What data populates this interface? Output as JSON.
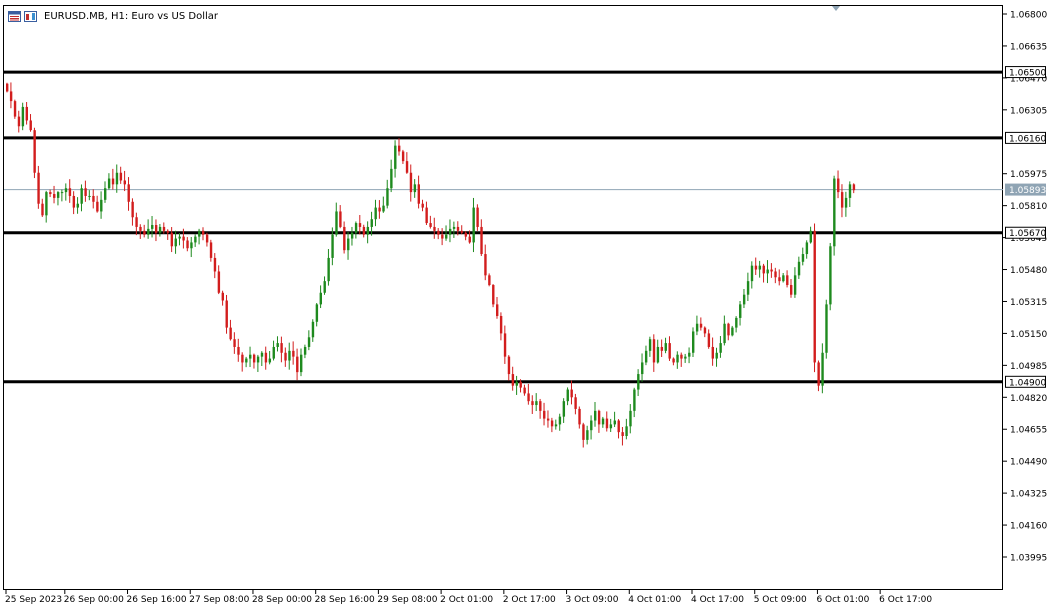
{
  "header": {
    "title": "EURUSD.MB, H1:  Euro vs US Dollar",
    "icons": [
      "chart-menu-icon",
      "one-click-trading-icon"
    ]
  },
  "colors": {
    "bull": "#1e8a1e",
    "bear": "#d21d1d",
    "level_line": "#000000",
    "bid_line": "#8fa4b4",
    "background": "#ffffff"
  },
  "price_axis": {
    "ticks": [
      "1.06800",
      "1.06635",
      "1.06470",
      "1.06305",
      "1.05975",
      "1.05810",
      "1.05645",
      "1.05480",
      "1.05315",
      "1.05150",
      "1.04985",
      "1.04820",
      "1.04655",
      "1.04490",
      "1.04325",
      "1.04160",
      "1.03995"
    ],
    "tick_values": [
      1.068,
      1.06635,
      1.0647,
      1.06305,
      1.05975,
      1.0581,
      1.05645,
      1.0548,
      1.05315,
      1.0515,
      1.04985,
      1.0482,
      1.04655,
      1.0449,
      1.04325,
      1.0416,
      1.03995
    ]
  },
  "time_axis": {
    "labels": [
      "25 Sep 2023",
      "26 Sep 00:00",
      "26 Sep 16:00",
      "27 Sep 08:00",
      "28 Sep 00:00",
      "28 Sep 16:00",
      "29 Sep 08:00",
      "2 Oct 01:00",
      "2 Oct 17:00",
      "3 Oct 09:00",
      "4 Oct 01:00",
      "4 Oct 17:00",
      "5 Oct 09:00",
      "6 Oct 01:00",
      "6 Oct 17:00"
    ],
    "label_bars": [
      0,
      15,
      31,
      47,
      63,
      79,
      95,
      111,
      127,
      143,
      159,
      175,
      191,
      207,
      223
    ]
  },
  "levels": [
    {
      "value": 1.065,
      "label": "1.06500"
    },
    {
      "value": 1.0616,
      "label": "1.06160"
    },
    {
      "value": 1.0567,
      "label": "1.05670"
    },
    {
      "value": 1.049,
      "label": "1.04900"
    }
  ],
  "current_price": {
    "value": 1.05893,
    "label": "1.05893"
  },
  "chart_data": {
    "type": "candlestick",
    "symbol": "EURUSD.MB",
    "timeframe": "H1",
    "ylim": [
      1.0383,
      1.0686
    ],
    "closes": [
      1.064,
      1.0635,
      1.0627,
      1.0622,
      1.0632,
      1.0625,
      1.062,
      1.0598,
      1.0582,
      1.0576,
      1.0588,
      1.0587,
      1.0585,
      1.0588,
      1.0588,
      1.059,
      1.0586,
      1.058,
      1.0582,
      1.059,
      1.0586,
      1.0586,
      1.0583,
      1.0578,
      1.0584,
      1.059,
      1.0595,
      1.0592,
      1.0598,
      1.0594,
      1.0592,
      1.0583,
      1.0575,
      1.057,
      1.0568,
      1.0566,
      1.0569,
      1.0571,
      1.0567,
      1.057,
      1.0568,
      1.0567,
      1.056,
      1.0564,
      1.0565,
      1.0563,
      1.0559,
      1.0562,
      1.0565,
      1.0568,
      1.0566,
      1.0562,
      1.0554,
      1.0547,
      1.0536,
      1.0532,
      1.0518,
      1.0512,
      1.0508,
      1.0504,
      1.05,
      1.0502,
      1.0504,
      1.05,
      1.0503,
      1.0505,
      1.05,
      1.0502,
      1.0508,
      1.051,
      1.0505,
      1.0501,
      1.0506,
      1.0503,
      1.0495,
      1.0504,
      1.0508,
      1.0513,
      1.0521,
      1.053,
      1.0536,
      1.0542,
      1.0554,
      1.0566,
      1.0578,
      1.057,
      1.0558,
      1.0564,
      1.0567,
      1.0572,
      1.057,
      1.0566,
      1.057,
      1.0574,
      1.058,
      1.0578,
      1.0581,
      1.059,
      1.06,
      1.0612,
      1.0609,
      1.0604,
      1.0598,
      1.0588,
      1.0592,
      1.0582,
      1.058,
      1.0572,
      1.057,
      1.0568,
      1.0566,
      1.0564,
      1.0566,
      1.0569,
      1.057,
      1.0568,
      1.0567,
      1.0565,
      1.0562,
      1.058,
      1.057,
      1.0556,
      1.0545,
      1.054,
      1.053,
      1.0524,
      1.0515,
      1.0503,
      1.0494,
      1.0488,
      1.049,
      1.0487,
      1.0484,
      1.048,
      1.0478,
      1.048,
      1.0475,
      1.0471,
      1.047,
      1.0467,
      1.0468,
      1.0472,
      1.048,
      1.0486,
      1.0482,
      1.0476,
      1.0468,
      1.046,
      1.0465,
      1.047,
      1.0475,
      1.0468,
      1.0471,
      1.0466,
      1.0468,
      1.047,
      1.0464,
      1.0462,
      1.0467,
      1.0475,
      1.0486,
      1.0494,
      1.05,
      1.0506,
      1.0512,
      1.05,
      1.0508,
      1.0506,
      1.051,
      1.0502,
      1.05,
      1.0504,
      1.0502,
      1.0503,
      1.0505,
      1.0516,
      1.052,
      1.0518,
      1.0515,
      1.0508,
      1.0502,
      1.0505,
      1.051,
      1.052,
      1.0514,
      1.0518,
      1.0523,
      1.053,
      1.0535,
      1.0542,
      1.055,
      1.0548,
      1.055,
      1.0546,
      1.0548,
      1.0547,
      1.0544,
      1.0542,
      1.0545,
      1.054,
      1.0535,
      1.0545,
      1.0552,
      1.0556,
      1.0562,
      1.0568,
      1.05,
      1.0488,
      1.0505,
      1.053,
      1.056,
      1.0595,
      1.0588,
      1.058,
      1.0585,
      1.0592,
      1.0589
    ]
  }
}
